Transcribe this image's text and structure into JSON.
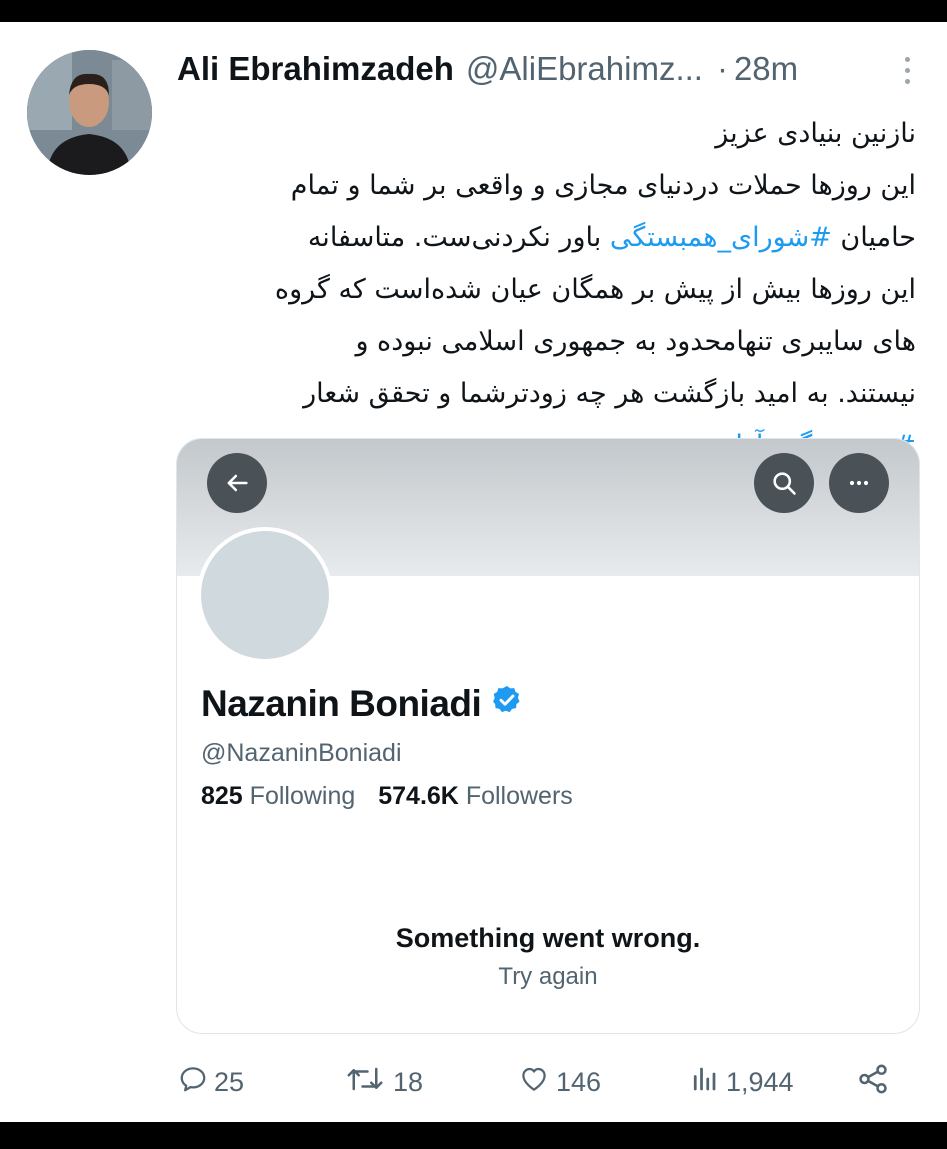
{
  "tweet": {
    "author_name": "Ali Ebrahimzadeh",
    "author_handle": "@AliEbrahimz...",
    "separator": "·",
    "time": "28m",
    "body_lines": [
      {
        "text": "نازنین بنیادی عزیز"
      },
      {
        "text": "این روزها حملات دردنیای مجازی و واقعی بر شما و تمام"
      },
      {
        "pre": "حامیان ",
        "hashtag": "#شورای_همبستگی",
        "post": " باور نکردنی‌ست. متاسفانه"
      },
      {
        "text": "این روزها بیش از پیش بر همگان عیان شده‌است که گروه"
      },
      {
        "text": "های سایبری تنهامحدود به جمهوری اسلامی نبوده و"
      },
      {
        "text": "نیستند. به امید بازگشت هر چه زودترشما و تحقق شعار"
      },
      {
        "hashtag": "#زن_زندگی_آزادی"
      }
    ]
  },
  "card": {
    "profile_name": "Nazanin Boniadi",
    "profile_handle": "@NazaninBoniadi",
    "following_count": "825",
    "following_label": "Following",
    "followers_count": "574.6K",
    "followers_label": "Followers",
    "error_title": "Something went wrong.",
    "error_retry": "Try again",
    "icons": [
      "back-arrow-icon",
      "search-icon",
      "more-icon",
      "verified-badge-icon"
    ]
  },
  "actions": {
    "replies": "25",
    "retweets": "18",
    "likes": "146",
    "views": "1,944"
  },
  "colors": {
    "link_blue": "#1d9bf0",
    "secondary_text": "#536471",
    "primary_text": "#0f1419",
    "banner_button": "#4a5157"
  }
}
